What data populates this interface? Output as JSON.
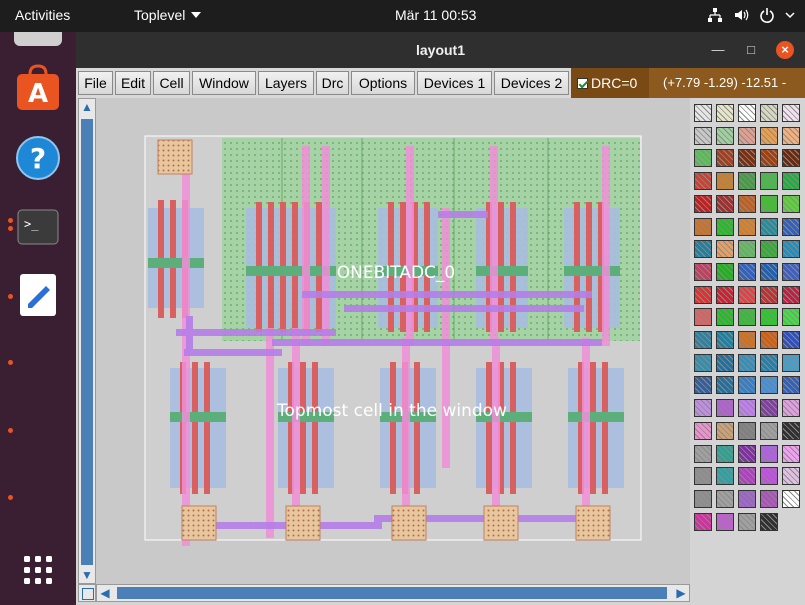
{
  "topbar": {
    "activities": "Activities",
    "app_menu": "Toplevel",
    "clock": "Mär 11  00:53",
    "tray_icons": [
      "network-icon",
      "volume-icon",
      "power-icon",
      "chevron-down-icon"
    ]
  },
  "dock": {
    "items": [
      "ubuntu-software-icon",
      "help-icon",
      "terminal-icon",
      "text-editor-icon",
      "show-apps-icon"
    ]
  },
  "window": {
    "title": "layout1",
    "controls": [
      "minimize",
      "maximize",
      "close"
    ]
  },
  "menubar": {
    "items": [
      "File",
      "Edit",
      "Cell",
      "Window",
      "Layers",
      "Drc",
      "Options",
      "Devices 1",
      "Devices 2"
    ],
    "drc_label": "DRC=0",
    "drc_checked": true,
    "coords": "(+7.79 -1.29) -12.51 -"
  },
  "canvas": {
    "cell_label": "ONEBITADC_0",
    "topmost_label": "Topmost cell in the window"
  },
  "palette": {
    "rows": 21,
    "cols": 5
  }
}
